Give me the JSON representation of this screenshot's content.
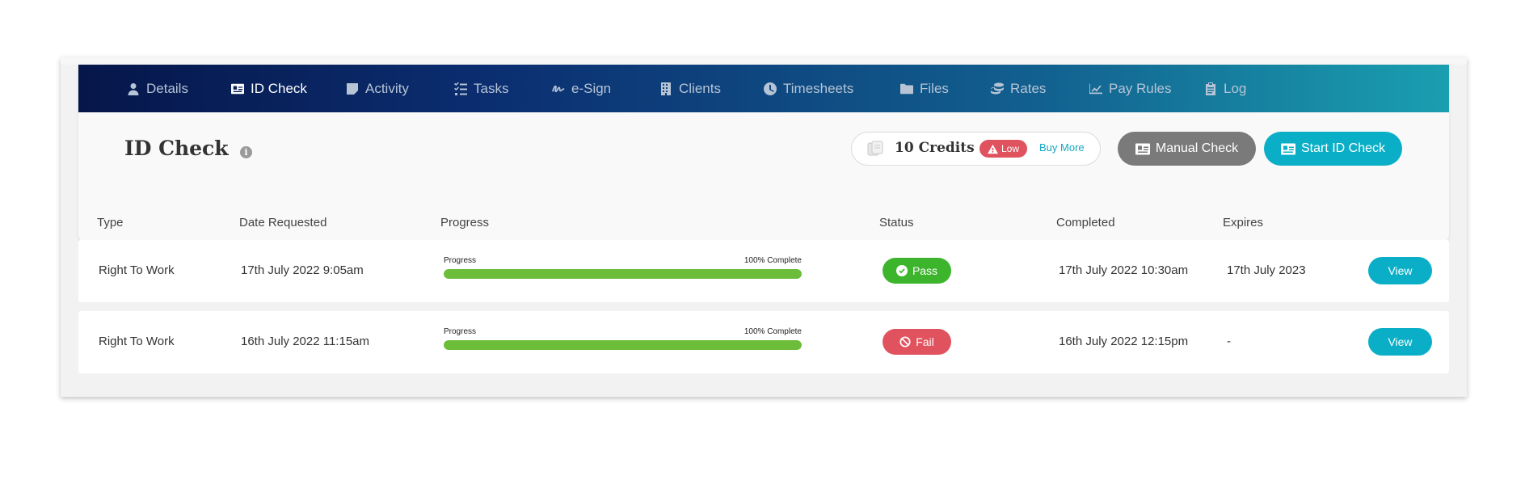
{
  "nav": {
    "items": [
      {
        "label": "Details",
        "icon": "user-icon"
      },
      {
        "label": "ID Check",
        "icon": "id-card-icon",
        "active": true
      },
      {
        "label": "Activity",
        "icon": "note-icon"
      },
      {
        "label": "Tasks",
        "icon": "tasks-icon"
      },
      {
        "label": "e-Sign",
        "icon": "signature-icon"
      },
      {
        "label": "Clients",
        "icon": "building-icon"
      },
      {
        "label": "Timesheets",
        "icon": "clock-icon"
      },
      {
        "label": "Files",
        "icon": "folder-icon"
      },
      {
        "label": "Rates",
        "icon": "coins-icon"
      },
      {
        "label": "Pay Rules",
        "icon": "chart-line-icon"
      },
      {
        "label": "Log",
        "icon": "clipboard-icon"
      }
    ]
  },
  "header": {
    "title": "ID Check",
    "credits": "10 Credits",
    "low_badge": "Low",
    "buy_more": "Buy More",
    "manual_check": "Manual Check",
    "start_id_check": "Start ID Check"
  },
  "table": {
    "columns": [
      "Type",
      "Date Requested",
      "Progress",
      "Status",
      "Completed",
      "Expires"
    ],
    "rows": [
      {
        "type": "Right To Work",
        "date_requested": "17th July 2022 9:05am",
        "progress_label": "Progress",
        "progress_text": "100% Complete",
        "progress_value": 100,
        "status": "Pass",
        "completed": "17th July 2022 10:30am",
        "expires": "17th July 2023",
        "action": "View"
      },
      {
        "type": "Right To Work",
        "date_requested": "16th July 2022 11:15am",
        "progress_label": "Progress",
        "progress_text": "100% Complete",
        "progress_value": 100,
        "status": "Fail",
        "completed": "16th July 2022 12:15pm",
        "expires": "-",
        "action": "View"
      }
    ]
  },
  "colors": {
    "accent": "#0aafc7",
    "pass": "#3cb52c",
    "fail": "#e0525e",
    "progress": "#6cbd3a",
    "nav_start": "#06164a",
    "nav_end": "#1a9fb0"
  }
}
